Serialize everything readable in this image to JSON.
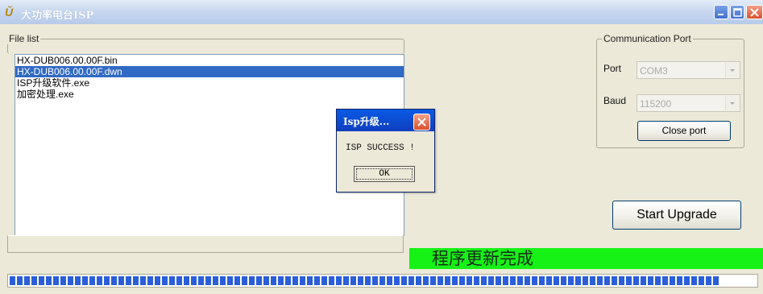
{
  "window": {
    "title": "大功率电台ISP",
    "icon": "app-logo-icon"
  },
  "file_list": {
    "label": "File list",
    "items": [
      {
        "name": "HX-DUB006.00.00F.bin",
        "selected": false
      },
      {
        "name": "HX-DUB006.00.00F.dwn",
        "selected": true
      },
      {
        "name": "ISP升级软件.exe",
        "selected": false
      },
      {
        "name": "加密处理.exe",
        "selected": false
      }
    ]
  },
  "comm_port": {
    "label": "Communication Port",
    "port_label": "Port",
    "port_value": "COM3",
    "baud_label": "Baud",
    "baud_value": "115200",
    "close_port_label": "Close port"
  },
  "start_upgrade_label": "Start Upgrade",
  "status": {
    "text": "程序更新完成",
    "color": "#16f116"
  },
  "progress": {
    "percent": 95
  },
  "dialog": {
    "title": "Isp升级...",
    "message": "ISP SUCCESS !",
    "ok_label": "OK"
  }
}
